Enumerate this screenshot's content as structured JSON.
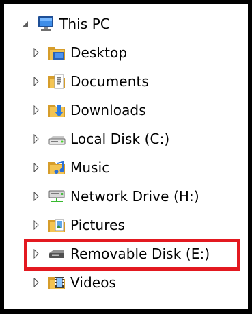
{
  "tree": {
    "root": {
      "label": "This PC",
      "icon": "computer-icon",
      "expanded": true
    },
    "items": [
      {
        "label": "Desktop",
        "icon": "desktop-folder-icon"
      },
      {
        "label": "Documents",
        "icon": "documents-folder-icon"
      },
      {
        "label": "Downloads",
        "icon": "downloads-folder-icon"
      },
      {
        "label": "Local Disk (C:)",
        "icon": "local-disk-icon"
      },
      {
        "label": "Music",
        "icon": "music-folder-icon"
      },
      {
        "label": "Network Drive (H:)",
        "icon": "network-drive-icon"
      },
      {
        "label": "Pictures",
        "icon": "pictures-folder-icon"
      },
      {
        "label": "Removable Disk (E:)",
        "icon": "removable-disk-icon",
        "highlighted": true
      },
      {
        "label": "Videos",
        "icon": "videos-folder-icon"
      }
    ]
  },
  "colors": {
    "highlight_border": "#e31920",
    "frame_border": "#000000",
    "folder_yellow": "#f3c453",
    "folder_dark": "#d69d2b"
  }
}
